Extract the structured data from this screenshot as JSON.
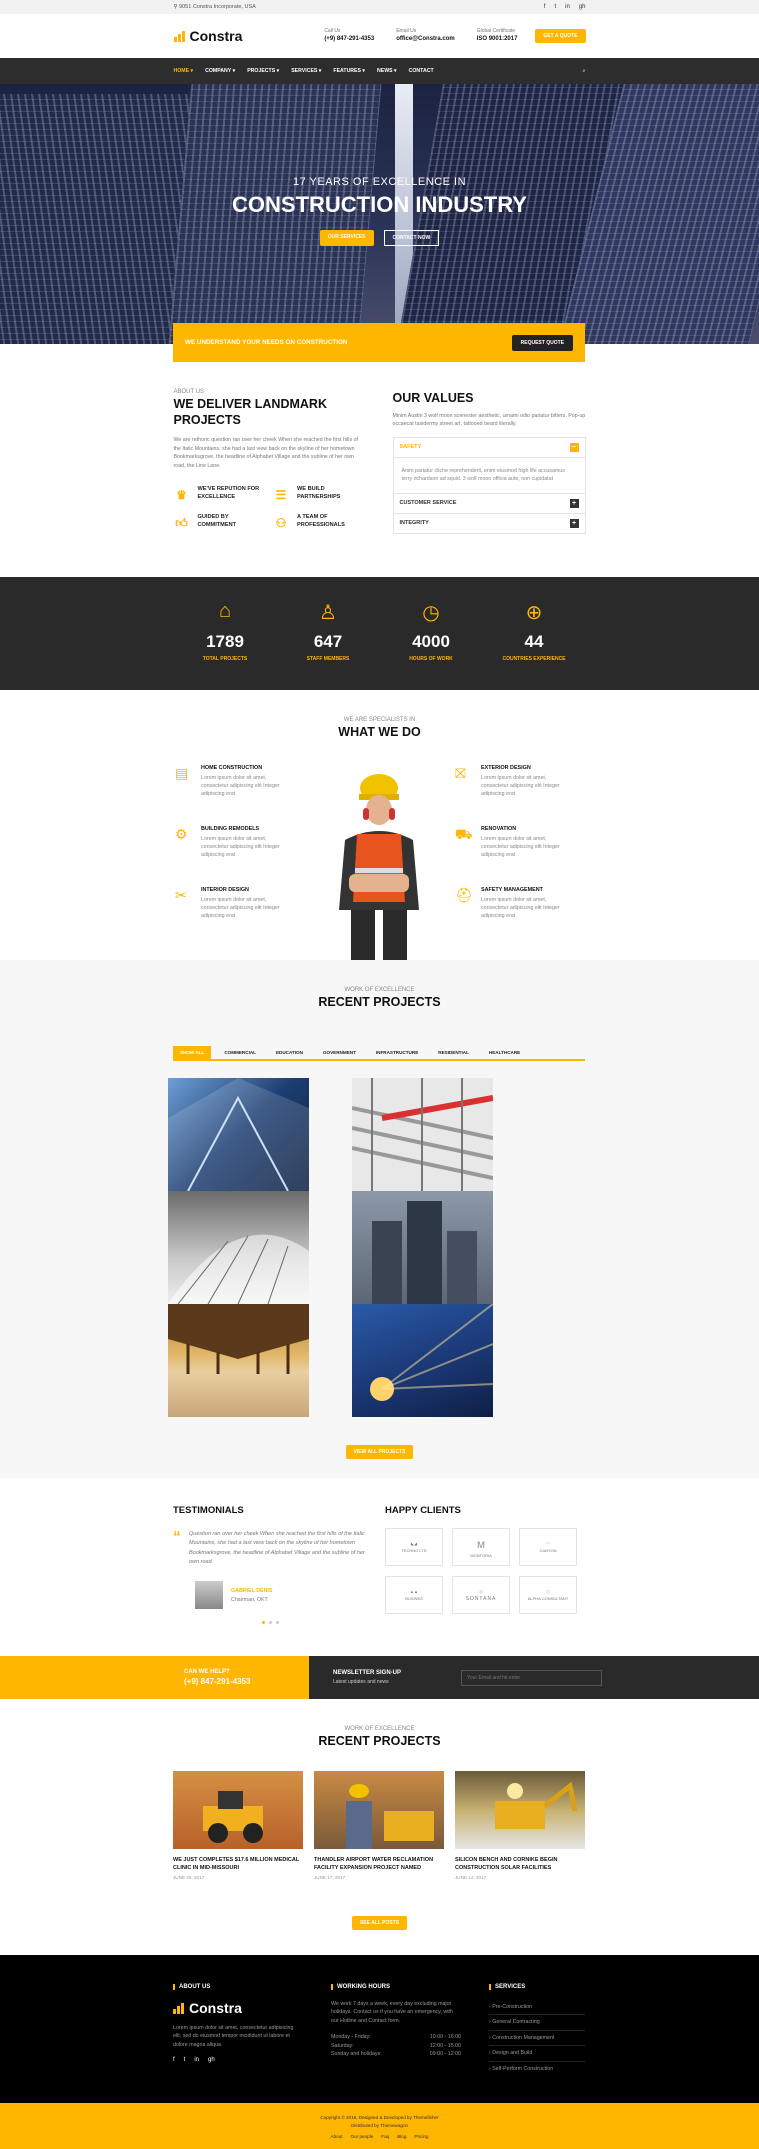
{
  "topbar": {
    "address": "9051 Constra Incorporate, USA",
    "social": [
      "f",
      "t",
      "in",
      "gh"
    ]
  },
  "header": {
    "logo": "Constra",
    "call_us": {
      "label": "Call Us",
      "value": "(+9) 847-291-4353"
    },
    "email_us": {
      "label": "Email Us",
      "value": "office@Constra.com"
    },
    "certificate": {
      "label": "Global Certificate",
      "value": "ISO 9001:2017"
    },
    "quote_button": "Get a Quote"
  },
  "nav": {
    "items": [
      "HOME ▾",
      "COMPANY ▾",
      "PROJECTS ▾",
      "SERVICES ▾",
      "FEATURES ▾",
      "NEWS ▾",
      "CONTACT"
    ],
    "active_index": 0
  },
  "hero": {
    "small": "17 YEARS OF EXCELLENCE IN",
    "big": "CONSTRUCTION INDUSTRY",
    "btn_primary": "Our Services",
    "btn_secondary": "Contact Now"
  },
  "cta": {
    "text": "WE UNDERSTAND YOUR NEEDS ON CONSTRUCTION",
    "button": "REQUEST QUOTE"
  },
  "about": {
    "kicker": "About Us",
    "title": "WE DELIVER LANDMARK PROJECTS",
    "text": "We are rethoric question ran over her cheek When she reached the first hills of the Italic Mountains, she had a last view back on the skyline of her hometown Bookmarksgrove, the headline of Alphabet Village and the subline of her own road, the Line Lane.",
    "features": [
      "WE'VE REPUTION FOR EXCELLENCE",
      "WE BUILD PARTNERSHIPS",
      "GUIDED BY COMMITMENT",
      "A TEAM OF PROFESSIONALS"
    ]
  },
  "values": {
    "title": "OUR VALUES",
    "text": "Minim Austin 3 wolf moon scenester aesthetic, umami odio pariatur bitters. Pop-up occaecat taxidermy street art, tattooed beard literally.",
    "accordion": [
      {
        "title": "SAFETY",
        "open": true,
        "body": "Anim pariatur cliche reprehenderit, enim eiusmod high life accusamus terry richardson ad squid. 3 wolf moon officia aute, non cupidatat"
      },
      {
        "title": "CUSTOMER SERVICE",
        "open": false
      },
      {
        "title": "INTEGRITY",
        "open": false
      }
    ]
  },
  "stats": [
    {
      "icon": "house-icon",
      "num": "1789",
      "label": "TOTAL PROJECTS"
    },
    {
      "icon": "worker-icon",
      "num": "647",
      "label": "STAFF MEMBERS"
    },
    {
      "icon": "clock-icon",
      "num": "4000",
      "label": "HOURS OF WORK"
    },
    {
      "icon": "globe-icon",
      "num": "44",
      "label": "COUNTRIES EXPERIENCE"
    }
  ],
  "what_we_do": {
    "kicker": "We Are Specialists In",
    "title": "WHAT WE DO",
    "services": [
      {
        "title": "HOME CONSTRUCTION",
        "text": "Lorem ipsum dolor sit amet, consectetur adipiscing elit Integer adipiscing erat"
      },
      {
        "title": "BUILDING REMODELS",
        "text": "Lorem ipsum dolor sit amet, consectetur adipiscing elit Integer adipiscing erat"
      },
      {
        "title": "INTERIOR DESIGN",
        "text": "Lorem ipsum dolor sit amet, consectetur adipiscing elit Integer adipiscing erat"
      },
      {
        "title": "EXTERIOR DESIGN",
        "text": "Lorem ipsum dolor sit amet, consectetur adipiscing elit Integer adipiscing erat"
      },
      {
        "title": "RENOVATION",
        "text": "Lorem ipsum dolor sit amet, consectetur adipiscing elit Integer adipiscing erat"
      },
      {
        "title": "SAFETY MANAGEMENT",
        "text": "Lorem ipsum dolor sit amet, consectetur adipiscing elit Integer adipiscing erat"
      }
    ]
  },
  "projects": {
    "kicker": "Work of Excellence",
    "title": "RECENT PROJECTS",
    "filters": [
      "SHOW ALL",
      "COMMERCIAL",
      "EDUCATION",
      "GOVERNMENT",
      "INFRASTRUCTURE",
      "RESIDENTIAL",
      "HEALTHCARE"
    ],
    "button": "VIEW ALL PROJECTS"
  },
  "testimonials": {
    "title": "TESTIMONIALS",
    "quote": "Question ran over her cheek When she reached the first hills of the Italic Mountains, she had a last view back on the skyline of her hometown Bookmarksgrove, the headline of Alphabet Village and the subline of her own road.",
    "name": "GABRIEL DENIS",
    "role": "Chairman, OKT"
  },
  "clients": {
    "title": "HAPPY CLIENTS",
    "items": [
      "TECHNO LTD",
      "MONTORIA",
      "CANYON",
      "BUSINES",
      "SONTANA",
      "ALPHA CONSULTANT"
    ]
  },
  "help": {
    "title": "CAN WE HELP?",
    "phone": "(+9) 847-291-4353",
    "news_title": "NEWSLETTER SIGN-UP",
    "news_sub": "Latest updates and news",
    "placeholder": "Your Email and hit enter"
  },
  "news": {
    "kicker": "Work of Excellence",
    "title": "RECENT PROJECTS",
    "items": [
      {
        "title": "WE JUST COMPLETES $17.6 MILLION MEDICAL CLINIC IN MID-MISSOURI",
        "date": "JUNE 29, 2017"
      },
      {
        "title": "THANDLER AIRPORT WATER RECLAMATION FACILITY EXPANSION PROJECT NAMED",
        "date": "JUNE 17, 2017"
      },
      {
        "title": "SILICON BENCH AND CORNIKE BEGIN CONSTRUCTION SOLAR FACILITIES",
        "date": "JUNE 12, 2017"
      }
    ],
    "button": "SEE ALL POSTS"
  },
  "footer": {
    "about_title": "ABOUT US",
    "logo": "Constra",
    "about_text": "Lorem ipsum dolor sit amet, consectetur adipisicing elit, sed do eiusmod tempor incididunt ut labore et dolore magna aliqua.",
    "hours_title": "WORKING HOURS",
    "hours_text": "We work 7 days a week, every day excluding major holidays. Contact us if you have an emergency, with our Hotline and Contact form.",
    "hours": [
      {
        "day": "Monday - Friday:",
        "time": "10:00 - 16:00"
      },
      {
        "day": "Saturday:",
        "time": "12:00 - 15:00"
      },
      {
        "day": "Sunday and holidays:",
        "time": "09:00 - 12:00"
      }
    ],
    "services_title": "SERVICES",
    "services": [
      "Pre-Construction",
      "General Contracting",
      "Construction Management",
      "Design and Build",
      "Self-Perform Construction"
    ],
    "copyright": "Copyright © 2019, Designed & Developed by Themefisher",
    "distributed": "Distributed by Themewagon",
    "links": [
      "About",
      "Our people",
      "Faq",
      "Blog",
      "Pricing"
    ]
  }
}
